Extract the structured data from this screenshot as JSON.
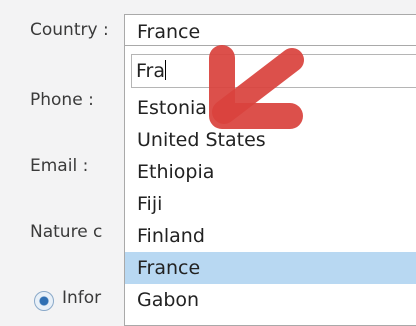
{
  "form": {
    "country_label": "Country :",
    "phone_label": "Phone :",
    "email_label": "Email :",
    "nature_label": "Nature c",
    "radio_label": "Infor"
  },
  "country_select": {
    "selected_value": "France",
    "search_value": "Fra",
    "options": [
      {
        "label": "Estonia"
      },
      {
        "label": "United States"
      },
      {
        "label": "Ethiopia"
      },
      {
        "label": "Fiji"
      },
      {
        "label": "Finland"
      },
      {
        "label": "France",
        "selected": true
      },
      {
        "label": "Gabon"
      }
    ]
  },
  "colors": {
    "highlight": "#b8d8f2",
    "arrow": "#d9433d"
  }
}
